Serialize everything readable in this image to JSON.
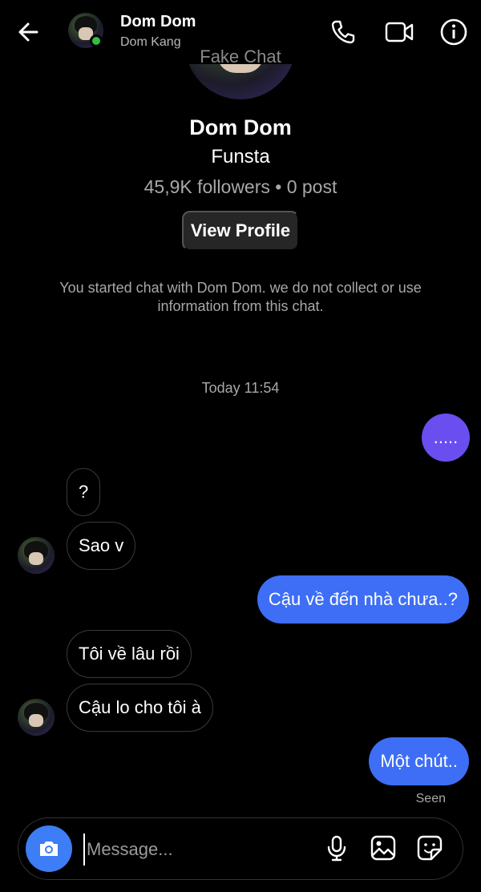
{
  "header": {
    "name": "Dom Dom",
    "subtitle": "Dom Kang"
  },
  "watermark": "Fake Chat",
  "profile": {
    "name": "Dom Dom",
    "handle": "Funsta",
    "stats": "45,9K followers • 0 post",
    "view_profile_label": "View Profile",
    "notice": "You started chat with Dom Dom. we do not collect or use information from this chat."
  },
  "timestamp": "Today 11:54",
  "messages": [
    {
      "from": "me",
      "text": "....."
    },
    {
      "from": "them",
      "text": "?"
    },
    {
      "from": "them",
      "text": "Sao v"
    },
    {
      "from": "me",
      "text": "Cậu về đến nhà chưa..?"
    },
    {
      "from": "them",
      "text": " Tôi về lâu rồi"
    },
    {
      "from": "them",
      "text": "Cậu lo cho tôi à"
    },
    {
      "from": "me",
      "text": "Một chút.."
    }
  ],
  "seen_label": "Seen",
  "composer": {
    "placeholder": "Message..."
  },
  "icons": [
    "back-arrow-icon",
    "phone-icon",
    "video-camera-icon",
    "info-icon",
    "camera-icon",
    "microphone-icon",
    "image-icon",
    "sticker-icon"
  ],
  "colors": {
    "background": "#000000",
    "outgoing_bubble": "#3d6ef5",
    "first_outgoing_bubble": "#6a4ef0",
    "camera_button": "#3d7df5",
    "online_dot": "#2fbf44"
  }
}
